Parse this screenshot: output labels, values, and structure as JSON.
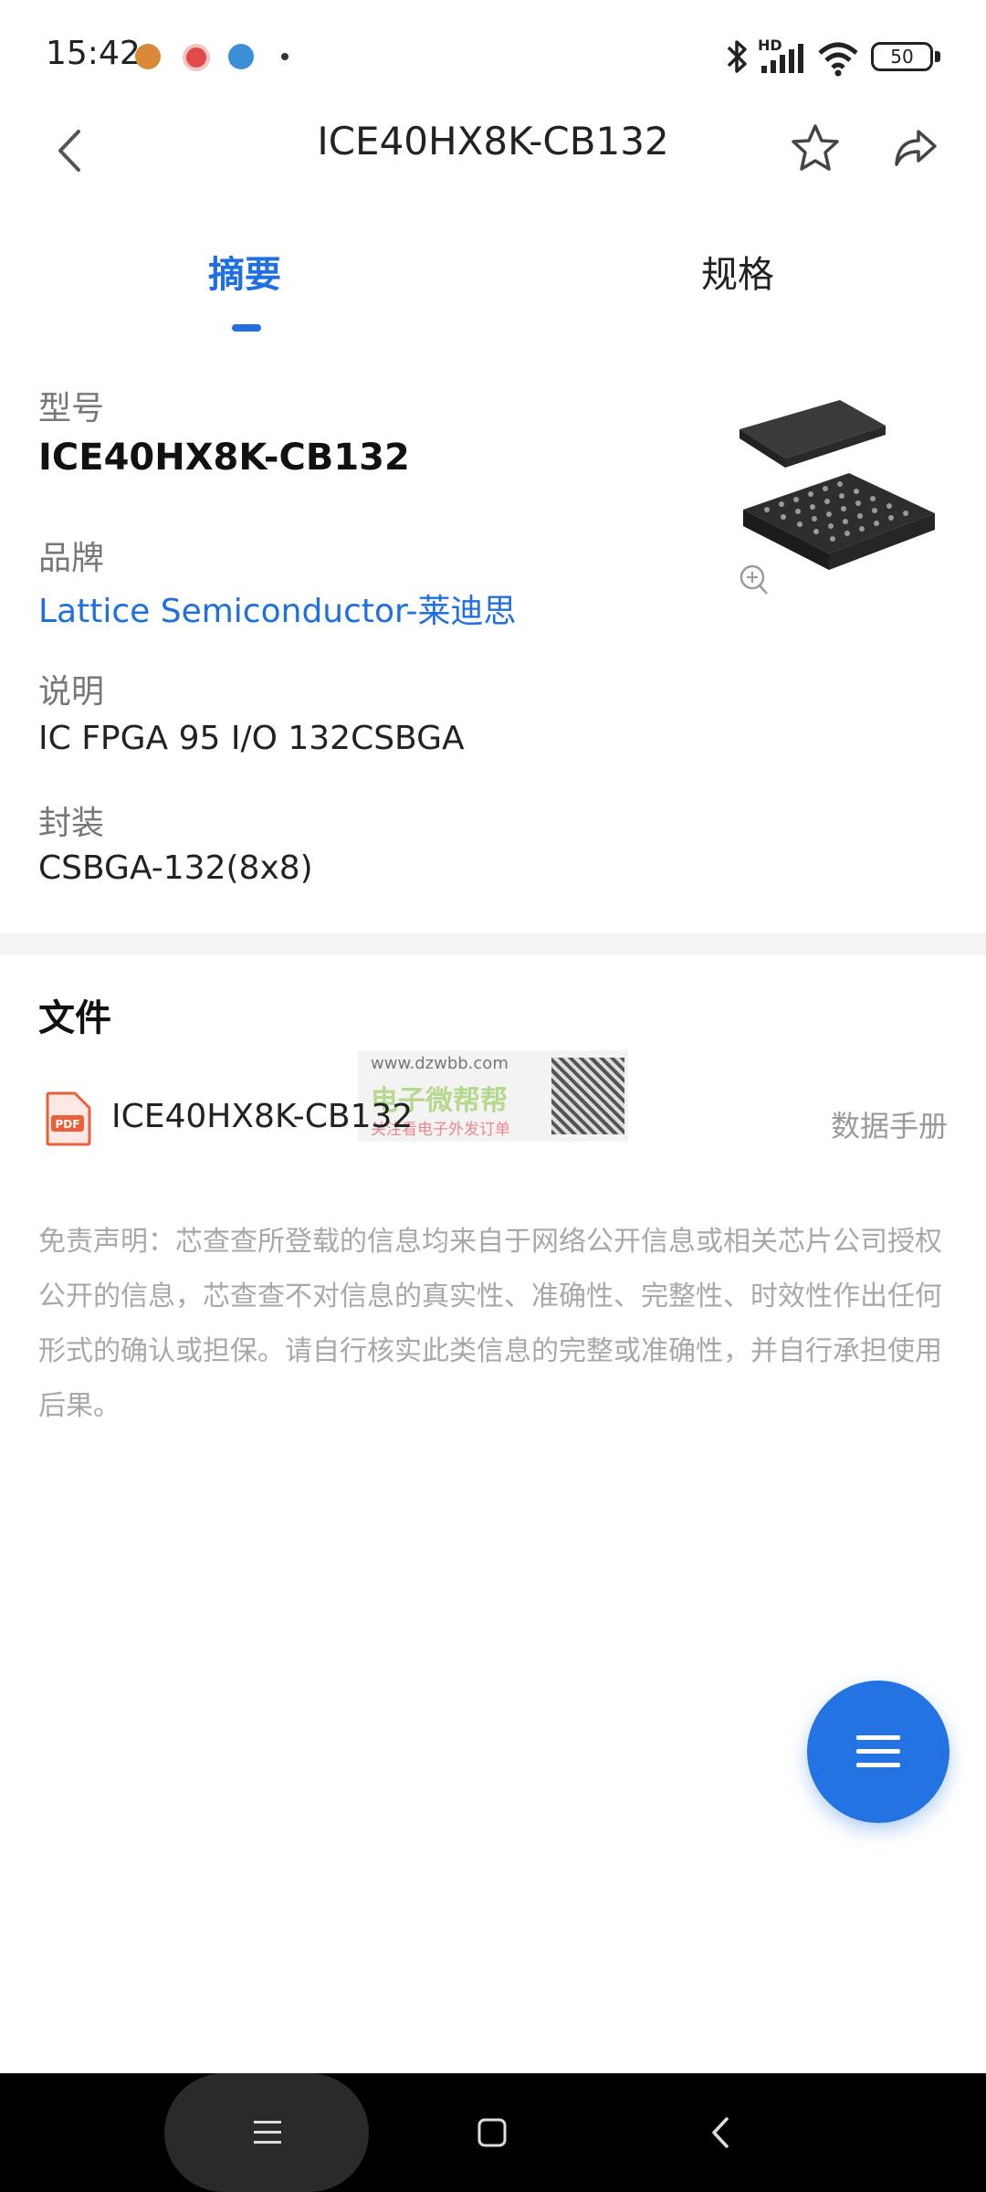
{
  "status_bar": {
    "time": "15:42",
    "network_label": "HD",
    "battery": "50"
  },
  "header": {
    "title": "ICE40HX8K-CB132",
    "icons": [
      "back-arrow-icon",
      "star-icon",
      "share-icon"
    ]
  },
  "tabs": [
    {
      "label": "摘要",
      "active": true
    },
    {
      "label": "规格",
      "active": false
    }
  ],
  "info": {
    "model_label": "型号",
    "model_value": "ICE40HX8K-CB132",
    "brand_label": "品牌",
    "brand_value": "Lattice Semiconductor-莱迪思",
    "desc_label": "说明",
    "desc_value": "IC FPGA 95 I/O 132CSBGA",
    "package_label": "封装",
    "package_value": "CSBGA-132(8x8)"
  },
  "files": {
    "section_title": "文件",
    "items": [
      {
        "icon_label": "PDF",
        "name": "ICE40HX8K-CB132",
        "type": "数据手册"
      }
    ]
  },
  "watermark": {
    "url": "www.dzwbb.com",
    "title": "电子微帮帮",
    "subtitle": "关注看电子外发订单"
  },
  "disclaimer": "免责声明：芯查查所登载的信息均来自于网络公开信息或相关芯片公司授权公开的信息，芯查查不对信息的真实性、准确性、完整性、时效性作出任何形式的确认或担保。请自行核实此类信息的完整或准确性，并自行承担使用后果。",
  "colors": {
    "accent": "#1f6fe0",
    "fab": "#2473e3"
  }
}
